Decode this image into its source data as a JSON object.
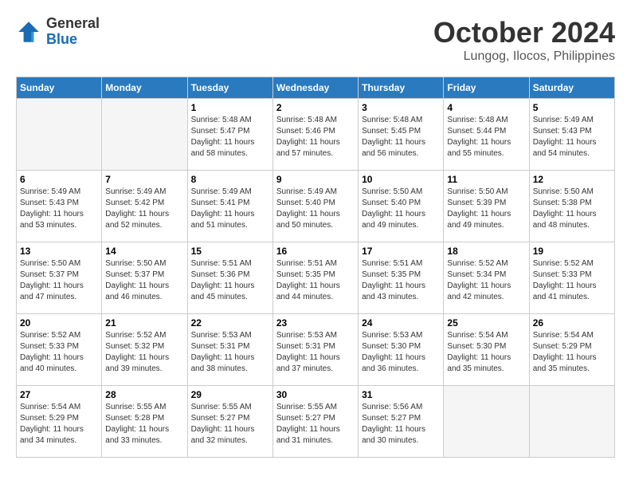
{
  "header": {
    "logo_general": "General",
    "logo_blue": "Blue",
    "month_title": "October 2024",
    "location": "Lungog, Ilocos, Philippines"
  },
  "weekdays": [
    "Sunday",
    "Monday",
    "Tuesday",
    "Wednesday",
    "Thursday",
    "Friday",
    "Saturday"
  ],
  "weeks": [
    [
      {
        "day": "",
        "sunrise": "",
        "sunset": "",
        "daylight": ""
      },
      {
        "day": "",
        "sunrise": "",
        "sunset": "",
        "daylight": ""
      },
      {
        "day": "1",
        "sunrise": "Sunrise: 5:48 AM",
        "sunset": "Sunset: 5:47 PM",
        "daylight": "Daylight: 11 hours and 58 minutes."
      },
      {
        "day": "2",
        "sunrise": "Sunrise: 5:48 AM",
        "sunset": "Sunset: 5:46 PM",
        "daylight": "Daylight: 11 hours and 57 minutes."
      },
      {
        "day": "3",
        "sunrise": "Sunrise: 5:48 AM",
        "sunset": "Sunset: 5:45 PM",
        "daylight": "Daylight: 11 hours and 56 minutes."
      },
      {
        "day": "4",
        "sunrise": "Sunrise: 5:48 AM",
        "sunset": "Sunset: 5:44 PM",
        "daylight": "Daylight: 11 hours and 55 minutes."
      },
      {
        "day": "5",
        "sunrise": "Sunrise: 5:49 AM",
        "sunset": "Sunset: 5:43 PM",
        "daylight": "Daylight: 11 hours and 54 minutes."
      }
    ],
    [
      {
        "day": "6",
        "sunrise": "Sunrise: 5:49 AM",
        "sunset": "Sunset: 5:43 PM",
        "daylight": "Daylight: 11 hours and 53 minutes."
      },
      {
        "day": "7",
        "sunrise": "Sunrise: 5:49 AM",
        "sunset": "Sunset: 5:42 PM",
        "daylight": "Daylight: 11 hours and 52 minutes."
      },
      {
        "day": "8",
        "sunrise": "Sunrise: 5:49 AM",
        "sunset": "Sunset: 5:41 PM",
        "daylight": "Daylight: 11 hours and 51 minutes."
      },
      {
        "day": "9",
        "sunrise": "Sunrise: 5:49 AM",
        "sunset": "Sunset: 5:40 PM",
        "daylight": "Daylight: 11 hours and 50 minutes."
      },
      {
        "day": "10",
        "sunrise": "Sunrise: 5:50 AM",
        "sunset": "Sunset: 5:40 PM",
        "daylight": "Daylight: 11 hours and 49 minutes."
      },
      {
        "day": "11",
        "sunrise": "Sunrise: 5:50 AM",
        "sunset": "Sunset: 5:39 PM",
        "daylight": "Daylight: 11 hours and 49 minutes."
      },
      {
        "day": "12",
        "sunrise": "Sunrise: 5:50 AM",
        "sunset": "Sunset: 5:38 PM",
        "daylight": "Daylight: 11 hours and 48 minutes."
      }
    ],
    [
      {
        "day": "13",
        "sunrise": "Sunrise: 5:50 AM",
        "sunset": "Sunset: 5:37 PM",
        "daylight": "Daylight: 11 hours and 47 minutes."
      },
      {
        "day": "14",
        "sunrise": "Sunrise: 5:50 AM",
        "sunset": "Sunset: 5:37 PM",
        "daylight": "Daylight: 11 hours and 46 minutes."
      },
      {
        "day": "15",
        "sunrise": "Sunrise: 5:51 AM",
        "sunset": "Sunset: 5:36 PM",
        "daylight": "Daylight: 11 hours and 45 minutes."
      },
      {
        "day": "16",
        "sunrise": "Sunrise: 5:51 AM",
        "sunset": "Sunset: 5:35 PM",
        "daylight": "Daylight: 11 hours and 44 minutes."
      },
      {
        "day": "17",
        "sunrise": "Sunrise: 5:51 AM",
        "sunset": "Sunset: 5:35 PM",
        "daylight": "Daylight: 11 hours and 43 minutes."
      },
      {
        "day": "18",
        "sunrise": "Sunrise: 5:52 AM",
        "sunset": "Sunset: 5:34 PM",
        "daylight": "Daylight: 11 hours and 42 minutes."
      },
      {
        "day": "19",
        "sunrise": "Sunrise: 5:52 AM",
        "sunset": "Sunset: 5:33 PM",
        "daylight": "Daylight: 11 hours and 41 minutes."
      }
    ],
    [
      {
        "day": "20",
        "sunrise": "Sunrise: 5:52 AM",
        "sunset": "Sunset: 5:33 PM",
        "daylight": "Daylight: 11 hours and 40 minutes."
      },
      {
        "day": "21",
        "sunrise": "Sunrise: 5:52 AM",
        "sunset": "Sunset: 5:32 PM",
        "daylight": "Daylight: 11 hours and 39 minutes."
      },
      {
        "day": "22",
        "sunrise": "Sunrise: 5:53 AM",
        "sunset": "Sunset: 5:31 PM",
        "daylight": "Daylight: 11 hours and 38 minutes."
      },
      {
        "day": "23",
        "sunrise": "Sunrise: 5:53 AM",
        "sunset": "Sunset: 5:31 PM",
        "daylight": "Daylight: 11 hours and 37 minutes."
      },
      {
        "day": "24",
        "sunrise": "Sunrise: 5:53 AM",
        "sunset": "Sunset: 5:30 PM",
        "daylight": "Daylight: 11 hours and 36 minutes."
      },
      {
        "day": "25",
        "sunrise": "Sunrise: 5:54 AM",
        "sunset": "Sunset: 5:30 PM",
        "daylight": "Daylight: 11 hours and 35 minutes."
      },
      {
        "day": "26",
        "sunrise": "Sunrise: 5:54 AM",
        "sunset": "Sunset: 5:29 PM",
        "daylight": "Daylight: 11 hours and 35 minutes."
      }
    ],
    [
      {
        "day": "27",
        "sunrise": "Sunrise: 5:54 AM",
        "sunset": "Sunset: 5:29 PM",
        "daylight": "Daylight: 11 hours and 34 minutes."
      },
      {
        "day": "28",
        "sunrise": "Sunrise: 5:55 AM",
        "sunset": "Sunset: 5:28 PM",
        "daylight": "Daylight: 11 hours and 33 minutes."
      },
      {
        "day": "29",
        "sunrise": "Sunrise: 5:55 AM",
        "sunset": "Sunset: 5:27 PM",
        "daylight": "Daylight: 11 hours and 32 minutes."
      },
      {
        "day": "30",
        "sunrise": "Sunrise: 5:55 AM",
        "sunset": "Sunset: 5:27 PM",
        "daylight": "Daylight: 11 hours and 31 minutes."
      },
      {
        "day": "31",
        "sunrise": "Sunrise: 5:56 AM",
        "sunset": "Sunset: 5:27 PM",
        "daylight": "Daylight: 11 hours and 30 minutes."
      },
      {
        "day": "",
        "sunrise": "",
        "sunset": "",
        "daylight": ""
      },
      {
        "day": "",
        "sunrise": "",
        "sunset": "",
        "daylight": ""
      }
    ]
  ]
}
